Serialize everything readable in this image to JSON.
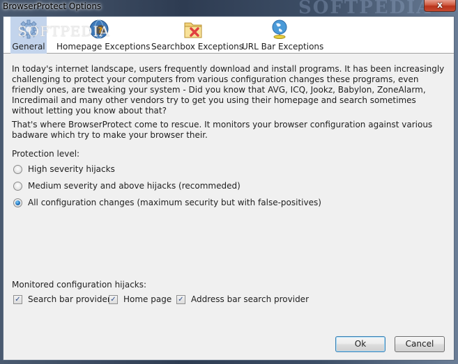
{
  "window": {
    "title": "BrowserProtect Options",
    "watermark": "SOFTPEDIA",
    "close_label": "x"
  },
  "tabs": [
    {
      "label": "General",
      "icon": "gear-icon",
      "active": true
    },
    {
      "label": "Homepage Exceptions",
      "icon": "globe-question-icon",
      "active": false
    },
    {
      "label": "Searchbox Exceptions",
      "icon": "folder-x-icon",
      "active": false
    },
    {
      "label": "URL Bar Exceptions",
      "icon": "globe-network-icon",
      "active": false
    }
  ],
  "content": {
    "paragraph1": "In today's internet landscape, users frequently download and install programs. It has been increasingly challenging to protect your computers from various configuration changes these programs, even friendly ones, are tweaking your system - Did you know that AVG, ICQ, Jookz, Babylon, ZoneAlarm, Incredimail and many other vendors try to get you using their homepage and search sometimes without letting you know about that?",
    "paragraph2": "That's where BrowserProtect come to rescue. It monitors your browser configuration against various badware which try to make your browser their.",
    "protection_label": "Protection level:",
    "protection_options": [
      {
        "label": "High severity hijacks",
        "checked": false
      },
      {
        "label": "Medium severity and above hijacks (recommeded)",
        "checked": false
      },
      {
        "label": "All configuration changes (maximum security but with false-positives)",
        "checked": true
      }
    ],
    "monitored_label": "Monitored configuration hijacks:",
    "monitored_options": [
      {
        "label": "Search bar provider",
        "checked": true
      },
      {
        "label": "Home page",
        "checked": true
      },
      {
        "label": "Address bar search provider",
        "checked": true
      }
    ]
  },
  "buttons": {
    "ok": "Ok",
    "cancel": "Cancel"
  },
  "colors": {
    "active_tab": "#c3d4ec",
    "client_bg": "#f0f0f0",
    "radio_selected": "#1e6fb8"
  }
}
